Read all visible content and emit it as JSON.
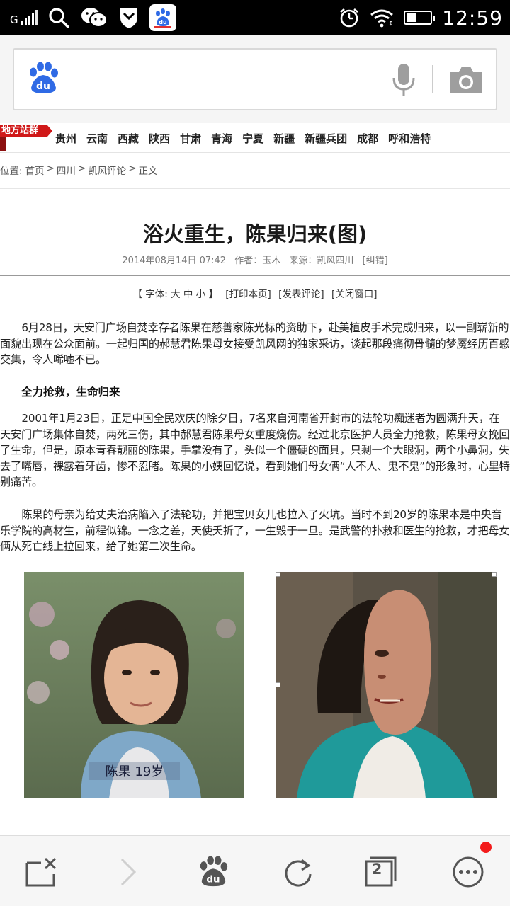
{
  "status_bar": {
    "carrier_mark": "G",
    "time": "12:59",
    "battery_level": 0.45,
    "icons": [
      "signal-icon",
      "search-icon",
      "wechat-icon",
      "shield-icon",
      "baidu-app-icon",
      "alarm-icon",
      "wifi-icon",
      "battery-icon"
    ]
  },
  "search": {
    "placeholder": "",
    "icons": [
      "baidu-logo-icon",
      "microphone-icon",
      "camera-icon"
    ]
  },
  "region_nav": {
    "badge": "地方站群",
    "items": [
      "贵州",
      "云南",
      "西藏",
      "陕西",
      "甘肃",
      "青海",
      "宁夏",
      "新疆",
      "新疆兵团",
      "成都",
      "呼和浩特"
    ]
  },
  "breadcrumb": {
    "prefix": "位置:",
    "items": [
      "首页",
      "四川",
      "凯风评论",
      "正文"
    ],
    "separator": ">"
  },
  "article": {
    "title": "浴火重生，陈果归来(图)",
    "date": "2014年08月14日 07:42",
    "author": "作者：玉木",
    "source": "来源：凯风四川",
    "error_link": "[纠错]",
    "font_label": "【 字体: 大 中 小 】",
    "print_link": "[打印本页]",
    "comment_link": "[发表评论]",
    "close_link": "[关闭窗口]",
    "paragraph_1": "6月28日，天安门广场自焚幸存者陈果在慈善家陈光标的资助下，赴美植皮手术完成归来，以一副崭新的面貌出现在公众面前。一起归国的郝慧君陈果母女接受凯风网的独家采访，谈起那段痛彻骨髓的梦魇经历百感交集，令人唏嘘不已。",
    "subheading": "全力抢救，生命归来",
    "paragraph_2": "2001年1月23日，正是中国全民欢庆的除夕日，7名来自河南省开封市的法轮功痴迷者为圆满升天，在天安门广场集体自焚，两死三伤，其中郝慧君陈果母女重度烧伤。经过北京医护人员全力抢救，陈果母女挽回了生命，但是，原本青春靓丽的陈果，手掌没有了，头似一个僵硬的面具，只剩一个大眼洞，两个小鼻洞，失去了嘴唇，裸露着牙齿，惨不忍睹。陈果的小姨回忆说，看到她们母女俩“人不人、鬼不鬼”的形象时，心里特别痛苦。",
    "paragraph_3": "陈果的母亲为给丈夫治病陷入了法轮功，并把宝贝女儿也拉入了火坑。当时不到20岁的陈果本是中央音乐学院的高材生，前程似锦。一念之差，天使夭折了，一生毁于一旦。是武警的扑救和医生的抢救，才把母女俩从死亡线上拉回来，给了她第二次生命。",
    "photo_1_caption": "陈果 19岁"
  },
  "bottom_bar": {
    "tab_count": "2",
    "icons": [
      "close-tab-icon",
      "forward-icon",
      "baidu-home-icon",
      "refresh-icon",
      "tabs-icon",
      "more-icon"
    ],
    "notification_color": "#f31c1c"
  },
  "colors": {
    "badge_red": "#d01818",
    "baidu_blue": "#2f6ae5",
    "toolbar_icon": "#555555"
  }
}
